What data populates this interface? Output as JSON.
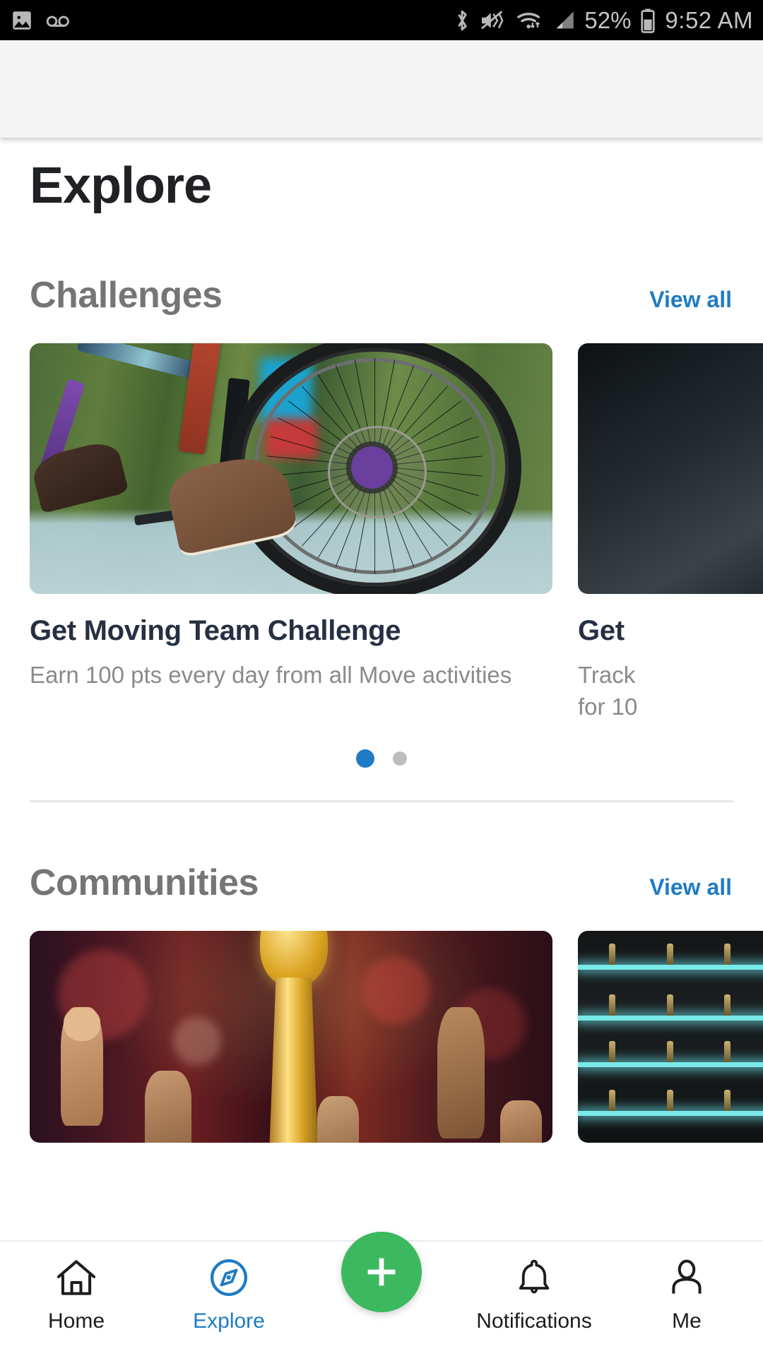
{
  "status_bar": {
    "time": "9:52 AM",
    "battery_percent": "52%",
    "icons": [
      "photo-icon",
      "voicemail-icon",
      "bluetooth-icon",
      "vibrate-icon",
      "wifi-icon",
      "cellular-signal-icon",
      "battery-icon"
    ]
  },
  "header": {
    "title": "Explore"
  },
  "sections": [
    {
      "title": "Challenges",
      "view_all_label": "View all",
      "cards": [
        {
          "title": "Get Moving Team Challenge",
          "subtitle": "Earn 100 pts every day from all Move activities",
          "image": "mountain-bike-wheel-motion-blur"
        },
        {
          "title": "Get",
          "subtitle": "Track\nfor 10",
          "image": "dark-water-rocks"
        }
      ],
      "pagination": {
        "total": 2,
        "active_index": 0
      }
    },
    {
      "title": "Communities",
      "view_all_label": "View all",
      "cards": [
        {
          "image": "championship-trophy-raised-fists"
        },
        {
          "image": "neon-lit-bar-shelves"
        }
      ]
    }
  ],
  "bottom_nav": {
    "items": [
      {
        "label": "Home",
        "icon": "home-icon",
        "active": false
      },
      {
        "label": "Explore",
        "icon": "compass-icon",
        "active": true
      },
      {
        "label": "Notifications",
        "icon": "bell-icon",
        "active": false
      },
      {
        "label": "Me",
        "icon": "person-icon",
        "active": false
      }
    ],
    "fab": {
      "icon": "plus-icon",
      "label": "Add"
    }
  },
  "colors": {
    "accent_blue": "#1f7bc4",
    "fab_green": "#3cb95f",
    "title_dark": "#1f2124",
    "section_gray": "#757575",
    "card_title": "#263043",
    "card_sub": "#8a8a8a",
    "toolbar_gray": "#f4f4f4"
  }
}
